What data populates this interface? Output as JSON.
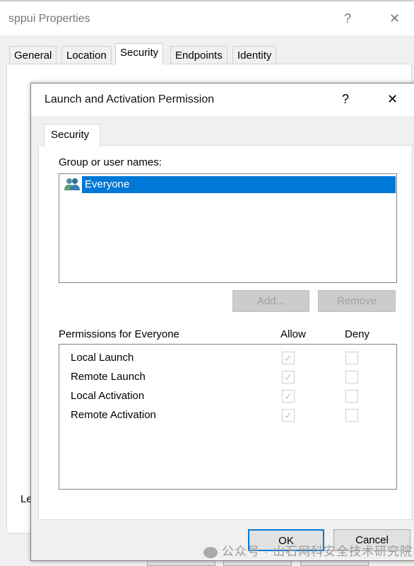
{
  "outer_window": {
    "title": "sppui Properties",
    "help": "?",
    "close": "✕",
    "tabs": [
      "General",
      "Location",
      "Security",
      "Endpoints",
      "Identity"
    ],
    "selected_tab": "Security",
    "partial_label": "Le"
  },
  "dialog": {
    "title": "Launch and Activation Permission",
    "help": "?",
    "close": "✕",
    "tab": "Security",
    "group_label": "Group or user names:",
    "users": [
      {
        "name": "Everyone",
        "icon": "users-icon",
        "selected": true
      }
    ],
    "add_label": "Add...",
    "remove_label": "Remove",
    "permissions_label": "Permissions for Everyone",
    "allow_header": "Allow",
    "deny_header": "Deny",
    "permissions": [
      {
        "name": "Local Launch",
        "allow": true,
        "deny": false
      },
      {
        "name": "Remote Launch",
        "allow": true,
        "deny": false
      },
      {
        "name": "Local Activation",
        "allow": true,
        "deny": false
      },
      {
        "name": "Remote Activation",
        "allow": true,
        "deny": false
      }
    ],
    "ok_label": "OK",
    "cancel_label": "Cancel"
  },
  "watermark": "公众号 · 山石网科安全技术研究院",
  "colors": {
    "selection": "#0078d7",
    "default_button_border": "#0078d7"
  }
}
